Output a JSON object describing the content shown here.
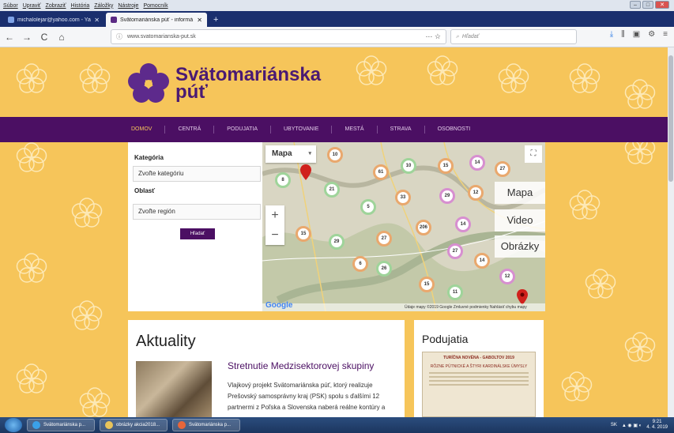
{
  "menubar": {
    "items": [
      "Súbor",
      "Upraviť",
      "Zobraziť",
      "História",
      "Záložky",
      "Nástroje",
      "Pomocník"
    ]
  },
  "tabs": [
    {
      "label": "michalolejar@yahoo.com - Ya",
      "close": "✕"
    },
    {
      "label": "Svätomariánska púť - informá",
      "close": "✕"
    }
  ],
  "newtab": "+",
  "nav": {
    "back": "←",
    "forward": "→",
    "reload": "C",
    "home": "⌂",
    "url": "www.svatomarianska-put.sk",
    "search_placeholder": "Hľadať",
    "url_right": "··· ☆"
  },
  "site": {
    "logo_line1": "Svätomariánska",
    "logo_line2": "púť",
    "menu": [
      "DOMOV",
      "CENTRÁ",
      "PODUJATIA",
      "UBYTOVANIE",
      "MESTÁ",
      "STRAVA",
      "OSOBNOSTI"
    ],
    "filter": {
      "category_label": "Kategória",
      "category_value": "Zvoľte kategóriu",
      "region_label": "Oblasť",
      "region_value": "Zvoľte región",
      "search_button": "Hľadať"
    },
    "map": {
      "type_label": "Mapa",
      "overlay_tabs": [
        "Mapa",
        "Video",
        "Obrázky"
      ],
      "zoom_in": "+",
      "zoom_out": "−",
      "logo": "Google",
      "footer": "Údaje mapy ©2019 Google   Zmluvné podmienky   Nahlásiť chybu mapy",
      "clusters": [
        "10",
        "8",
        "4",
        "61",
        "10",
        "15",
        "14",
        "27",
        "21",
        "33",
        "29",
        "12",
        "5",
        "206",
        "14",
        "15",
        "29",
        "27",
        "27",
        "6",
        "26",
        "14",
        "12",
        "15",
        "11",
        "8"
      ]
    },
    "news": {
      "heading": "Aktuality",
      "article_title": "Stretnutie Medzisektorovej skupiny",
      "article_text": "Vlajkový projekt Svätomariánska púť, ktorý realizuje Prešovský samosprávny kraj (PSK) spolu s ďalšími 12 partnermi z Poľska a Slovenska naberá reálne kontúry a"
    },
    "events": {
      "heading": "Podujatia",
      "poster_title": "TURÍČNA NOVÉNA - GABOLTOV 2019",
      "poster_sub": "RÔZNE PÚTNICKÉ A ŠTYRI KARDINÁLSKE ÚMYSLY"
    }
  },
  "taskbar": {
    "items": [
      "Svätomariánska p...",
      "obrázky akcia2018...",
      "Svätomariánska p..."
    ],
    "tray_lang": "SK",
    "clock_time": "9:21",
    "clock_date": "4. 4. 2019"
  }
}
